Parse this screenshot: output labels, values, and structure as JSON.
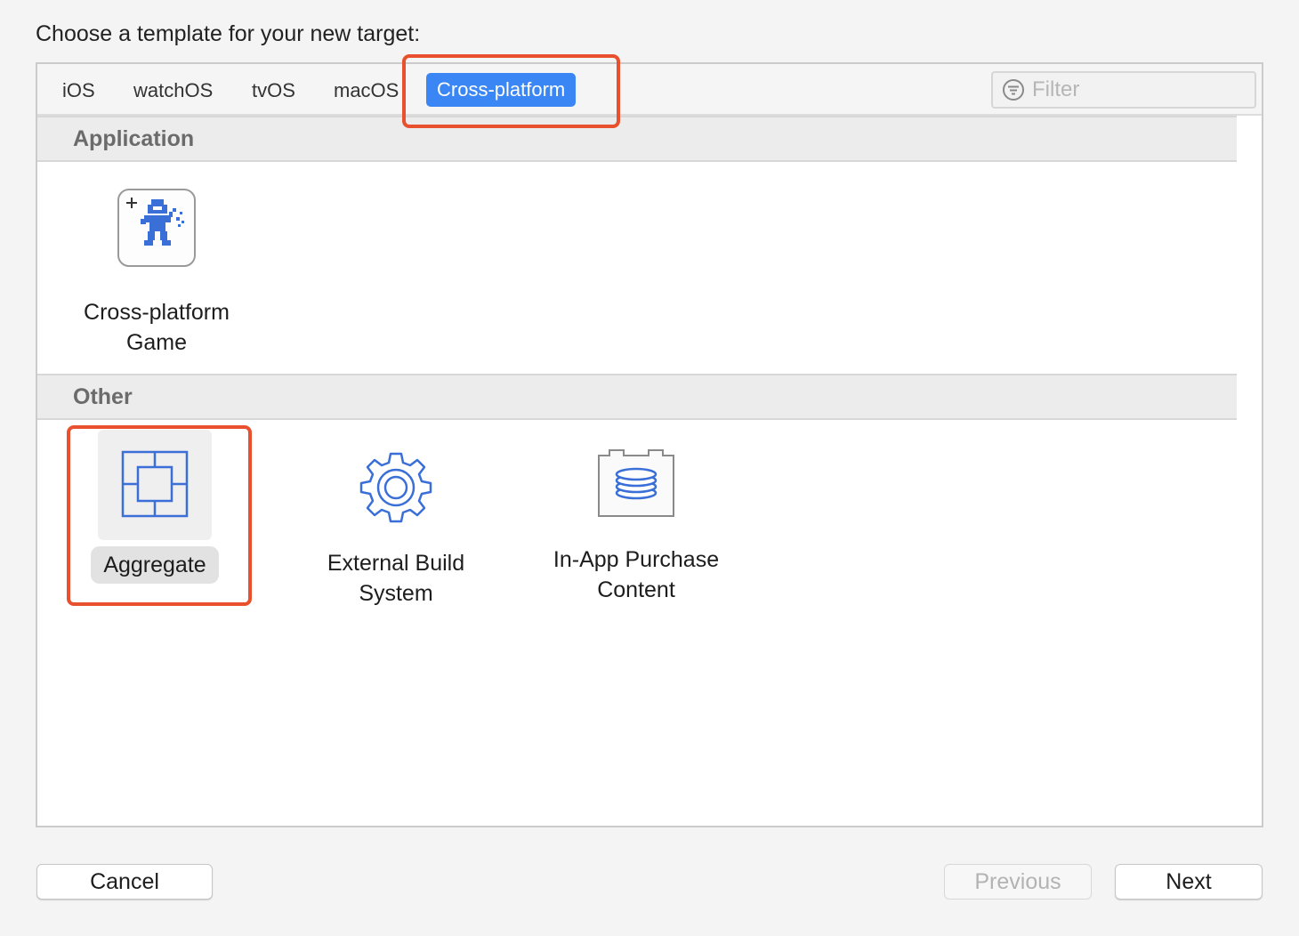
{
  "dialog": {
    "heading": "Choose a template for your new target:"
  },
  "tabs": [
    {
      "label": "iOS",
      "active": false
    },
    {
      "label": "watchOS",
      "active": false
    },
    {
      "label": "tvOS",
      "active": false
    },
    {
      "label": "macOS",
      "active": false
    },
    {
      "label": "Cross-platform",
      "active": true
    }
  ],
  "filter": {
    "placeholder": "Filter",
    "value": ""
  },
  "sections": [
    {
      "title": "Application",
      "templates": [
        {
          "label_line1": "Cross-platform",
          "label_line2": "Game",
          "icon": "game-sprite-icon"
        }
      ]
    },
    {
      "title": "Other",
      "templates": [
        {
          "label_line1": "Aggregate",
          "label_line2": "",
          "icon": "aggregate-icon",
          "selected": true
        },
        {
          "label_line1": "External Build",
          "label_line2": "System",
          "icon": "gear-icon"
        },
        {
          "label_line1": "In-App Purchase",
          "label_line2": "Content",
          "icon": "database-box-icon"
        }
      ]
    }
  ],
  "buttons": {
    "cancel": "Cancel",
    "previous": "Previous",
    "next": "Next"
  },
  "colors": {
    "accent": "#3a86f5",
    "highlight": "#e8502e",
    "icon_blue": "#3a6fd8"
  }
}
